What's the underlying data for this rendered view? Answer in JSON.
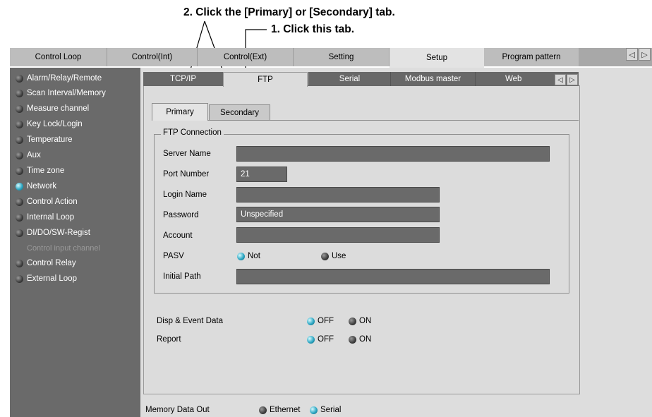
{
  "annotations": {
    "callout_secondary": "2. Click the [Primary] or [Secondary] tab.",
    "callout_ftp": "1. Click this tab."
  },
  "top_tabs": [
    {
      "label": "Control Loop",
      "active": false
    },
    {
      "label": "Control(Int)",
      "active": false
    },
    {
      "label": "Control(Ext)",
      "active": false
    },
    {
      "label": "Setting",
      "active": false
    },
    {
      "label": "Setup",
      "active": true
    },
    {
      "label": "Program pattern",
      "active": false
    }
  ],
  "top_arrows": {
    "left": "◁",
    "right": "▷"
  },
  "sidebar": {
    "items": [
      {
        "label": "Alarm/Relay/Remote",
        "active": false
      },
      {
        "label": "Scan Interval/Memory",
        "active": false
      },
      {
        "label": "Measure channel",
        "active": false
      },
      {
        "label": "Key Lock/Login",
        "active": false
      },
      {
        "label": "Temperature",
        "active": false
      },
      {
        "label": "Aux",
        "active": false
      },
      {
        "label": "Time zone",
        "active": false
      },
      {
        "label": "Network",
        "active": true
      },
      {
        "label": "Control Action",
        "active": false
      },
      {
        "label": "Internal Loop",
        "active": false
      },
      {
        "label": "DI/DO/SW-Regist",
        "active": false
      },
      {
        "label": "Control input channel",
        "active": false,
        "disabled": true
      },
      {
        "label": "Control Relay",
        "active": false
      },
      {
        "label": "External Loop",
        "active": false
      }
    ]
  },
  "network_tabs": [
    {
      "label": "TCP/IP",
      "active": false
    },
    {
      "label": "FTP",
      "active": true
    },
    {
      "label": "Serial",
      "active": false
    },
    {
      "label": "Modbus master",
      "active": false
    },
    {
      "label": "Web",
      "active": false
    }
  ],
  "network_arrows": {
    "left": "◁",
    "right": "▷"
  },
  "ftp_subtabs": [
    {
      "label": "Primary",
      "active": true
    },
    {
      "label": "Secondary",
      "active": false
    }
  ],
  "ftp_connection": {
    "group_label": "FTP Connection",
    "server_name": {
      "label": "Server Name",
      "value": ""
    },
    "port_number": {
      "label": "Port Number",
      "value": "21"
    },
    "login_name": {
      "label": "Login Name",
      "value": ""
    },
    "password": {
      "label": "Password",
      "value": "Unspecified"
    },
    "account": {
      "label": "Account",
      "value": ""
    },
    "pasv": {
      "label": "PASV",
      "options": [
        "Not",
        "Use"
      ],
      "selected": "Not"
    },
    "initial_path": {
      "label": "Initial Path",
      "value": ""
    }
  },
  "transfer": {
    "disp_event": {
      "label": "Disp & Event Data",
      "options": [
        "OFF",
        "ON"
      ],
      "selected": "OFF"
    },
    "report": {
      "label": "Report",
      "options": [
        "OFF",
        "ON"
      ],
      "selected": "OFF"
    }
  },
  "memory_data_out": {
    "label": "Memory Data Out",
    "options": [
      "Ethernet",
      "Serial"
    ],
    "selected": "Serial"
  },
  "colors": {
    "led_on": "#2fa8c4",
    "sidebar_bg": "#6a6a6a",
    "field_bg": "#6a6a6a"
  }
}
